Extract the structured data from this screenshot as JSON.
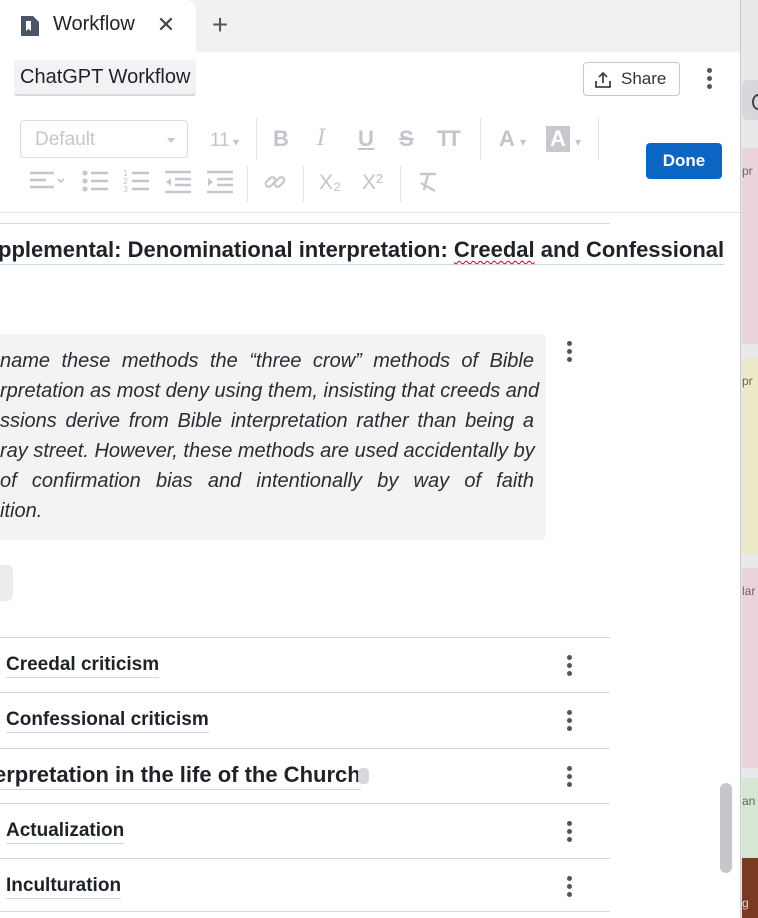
{
  "tab": {
    "title": "Workflow",
    "close_glyph": "✕",
    "add_glyph": "+"
  },
  "header": {
    "doc_title": "ChatGPT Workflow",
    "share_label": "Share"
  },
  "toolbar": {
    "style_value": "Default",
    "font_size": "11",
    "caret": "▾",
    "bold": "B",
    "italic": "I",
    "underline": "U",
    "strike": "S",
    "text_size": "TT",
    "font_color": "A",
    "highlight": "A",
    "subscript": "X₂",
    "superscript": "X²",
    "done_label": "Done"
  },
  "content": {
    "heading_before": "pplemental: Denominational interpretation: ",
    "heading_misspelled": "Creedal",
    "heading_after": " and Confessional",
    "quote_lines": [
      "name these methods the “three crow” methods of Bible",
      "rpretation as most deny using them, insisting that creeds and",
      "ssions derive from Bible interpretation rather than being a",
      "ray street. However, these methods are used accidentally by",
      "of confirmation bias and intentionally by way of faith",
      "ition."
    ],
    "rows": [
      {
        "label": "Creedal criticism"
      },
      {
        "label": "Confessional criticism"
      },
      {
        "label": "erpretation in the life of the Church"
      },
      {
        "label": "Actualization"
      },
      {
        "label": "Inculturation"
      }
    ]
  },
  "background_snippets": [
    "pr",
    "pr",
    "lar",
    "an",
    "g"
  ],
  "colors": {
    "accent": "#0a66c2",
    "card_pink": "#ead3dc",
    "card_yellow": "#ece9c8",
    "card_green": "#d5e6d3"
  }
}
